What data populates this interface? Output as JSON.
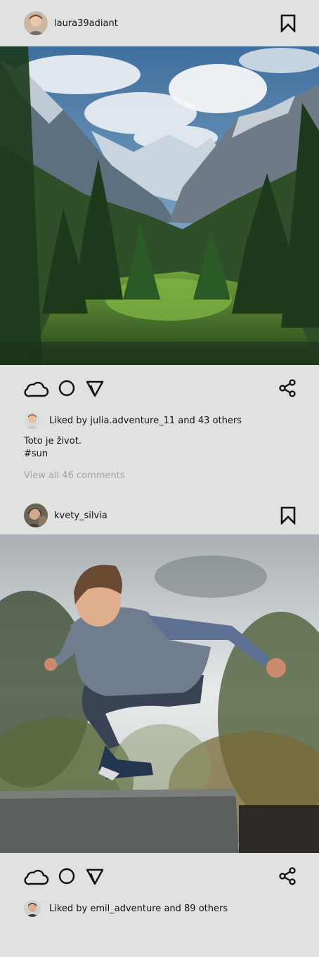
{
  "posts": [
    {
      "username": "laura39adiant",
      "liked_by_user": "julia.adventure_11",
      "liked_text": "Liked by julia.adventure_11 and 43 others",
      "caption_line1": "Toto je život.",
      "caption_line2": "#sun",
      "view_comments": "View all 46 comments"
    },
    {
      "username": "kvety_silvia",
      "liked_by_user": "emil_adventure",
      "liked_text": "Liked by emil_adventure and 89 others"
    }
  ],
  "icons": {
    "like": "cloud-icon",
    "comment": "circle-icon",
    "send": "send-icon",
    "share": "share-icon",
    "save": "bookmark-icon"
  },
  "colors": {
    "background": "#e0e2e1",
    "text": "#111111",
    "muted": "#a3a6a6"
  }
}
